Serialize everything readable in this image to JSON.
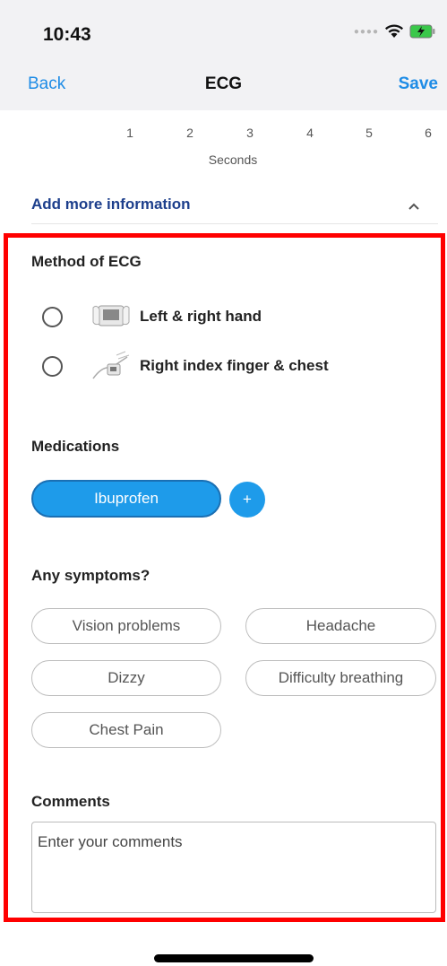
{
  "status_bar": {
    "time": "10:43"
  },
  "nav": {
    "back_label": "Back",
    "title": "ECG",
    "save_label": "Save"
  },
  "chart_axis": {
    "ticks": [
      "1",
      "2",
      "3",
      "4",
      "5",
      "6"
    ],
    "label": "Seconds"
  },
  "more_info": {
    "label": "Add more information"
  },
  "method": {
    "title": "Method of ECG",
    "options": [
      {
        "label": "Left & right hand",
        "icon": "hands-device-icon"
      },
      {
        "label": "Right index finger & chest",
        "icon": "finger-chest-icon"
      }
    ]
  },
  "medications": {
    "title": "Medications",
    "items": [
      "Ibuprofen"
    ],
    "add_label": "+"
  },
  "symptoms": {
    "title": "Any symptoms?",
    "items": [
      "Vision problems",
      "Headache",
      "Dizzy",
      "Difficulty breathing",
      "Chest Pain"
    ]
  },
  "comments": {
    "title": "Comments",
    "placeholder": "Enter your comments"
  },
  "colors": {
    "accent": "#1e9bea",
    "link": "#1e8ce6",
    "highlight": "#ff0000",
    "more_link": "#1d3f8c"
  }
}
